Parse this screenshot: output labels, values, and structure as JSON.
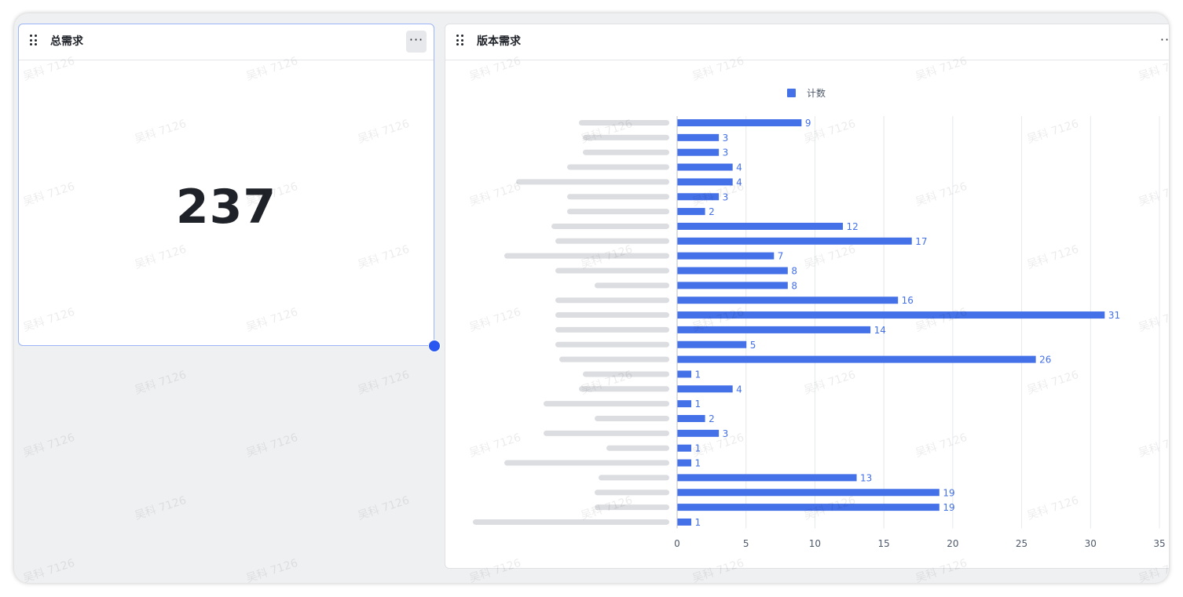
{
  "total_card": {
    "title": "总需求",
    "more_label": "···",
    "value": "237"
  },
  "version_card": {
    "title": "版本需求",
    "more_label": "···"
  },
  "watermark_text": "吴科 7126",
  "colors": {
    "bar": "#4470e8",
    "accent_border": "#9db4f7",
    "handle": "#2a57f0"
  },
  "chart_data": {
    "type": "bar",
    "orientation": "horizontal",
    "legend": {
      "label": "计数",
      "position": "top-center"
    },
    "categories_blurred": true,
    "values": [
      9,
      3,
      3,
      4,
      4,
      3,
      2,
      12,
      17,
      7,
      8,
      8,
      16,
      31,
      14,
      5,
      26,
      1,
      4,
      1,
      2,
      3,
      1,
      1,
      13,
      19,
      19,
      1
    ],
    "xlim": [
      0,
      35
    ],
    "xticks": [
      0,
      5,
      10,
      15,
      20,
      25,
      30,
      35
    ],
    "grid": "vertical"
  }
}
